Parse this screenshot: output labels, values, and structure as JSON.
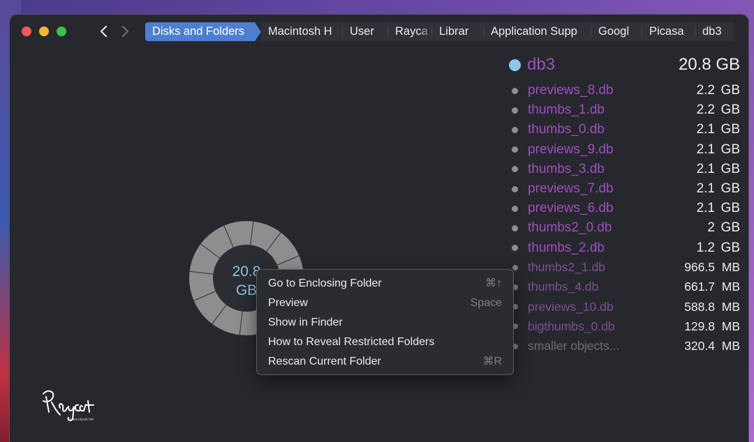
{
  "window": {
    "nav": {
      "back_icon": "chevron-left-icon",
      "forward_icon": "chevron-right-icon"
    },
    "breadcrumb": [
      {
        "label": "Disks and Folders",
        "active": true
      },
      {
        "label": "Macintosh H"
      },
      {
        "label": "User"
      },
      {
        "label": "Rayca"
      },
      {
        "label": "Librar"
      },
      {
        "label": "Application Supp"
      },
      {
        "label": "Googl"
      },
      {
        "label": "Picasa"
      },
      {
        "label": "db3"
      }
    ]
  },
  "donut": {
    "center_line1": "20.8",
    "center_line2": "GB",
    "ring_color": "#8e8e8e",
    "center_color": "#2b2d32",
    "segments": 12
  },
  "folder": {
    "name": "db3",
    "size": "20.8 GB",
    "dot_color": "#8cc8ee",
    "items": [
      {
        "name": "previews_8.db",
        "num": "2.2",
        "unit": "GB"
      },
      {
        "name": "thumbs_1.db",
        "num": "2.2",
        "unit": "GB"
      },
      {
        "name": "thumbs_0.db",
        "num": "2.1",
        "unit": "GB"
      },
      {
        "name": "previews_9.db",
        "num": "2.1",
        "unit": "GB"
      },
      {
        "name": "thumbs_3.db",
        "num": "2.1",
        "unit": "GB"
      },
      {
        "name": "previews_7.db",
        "num": "2.1",
        "unit": "GB"
      },
      {
        "name": "previews_6.db",
        "num": "2.1",
        "unit": "GB"
      },
      {
        "name": "thumbs2_0.db",
        "num": "2",
        "unit": "GB"
      },
      {
        "name": "thumbs_2.db",
        "num": "1.2",
        "unit": "GB"
      },
      {
        "name": "thumbs2_1.db",
        "num": "966.5",
        "unit": "MB"
      },
      {
        "name": "thumbs_4.db",
        "num": "661.7",
        "unit": "MB"
      },
      {
        "name": "previews_10.db",
        "num": "588.8",
        "unit": "MB"
      },
      {
        "name": "bigthumbs_0.db",
        "num": "129.8",
        "unit": "MB"
      },
      {
        "name": "smaller objects...",
        "num": "320.4",
        "unit": "MB"
      }
    ]
  },
  "context_menu": {
    "items": [
      {
        "label": "Go to Enclosing Folder",
        "shortcut": "⌘↑"
      },
      {
        "label": "Preview",
        "shortcut": "Space"
      },
      {
        "label": "Show in Finder",
        "shortcut": ""
      },
      {
        "label": "How to Reveal Restricted Folders",
        "shortcut": ""
      },
      {
        "label": "Rescan Current Folder",
        "shortcut": "⌘R"
      }
    ]
  },
  "watermark": {
    "text": "Raycat",
    "subtext": "www.raycat.net"
  },
  "colors": {
    "accent": "#4d7fd1",
    "file_name": "#a04ebf",
    "window_bg": "#26282d"
  }
}
